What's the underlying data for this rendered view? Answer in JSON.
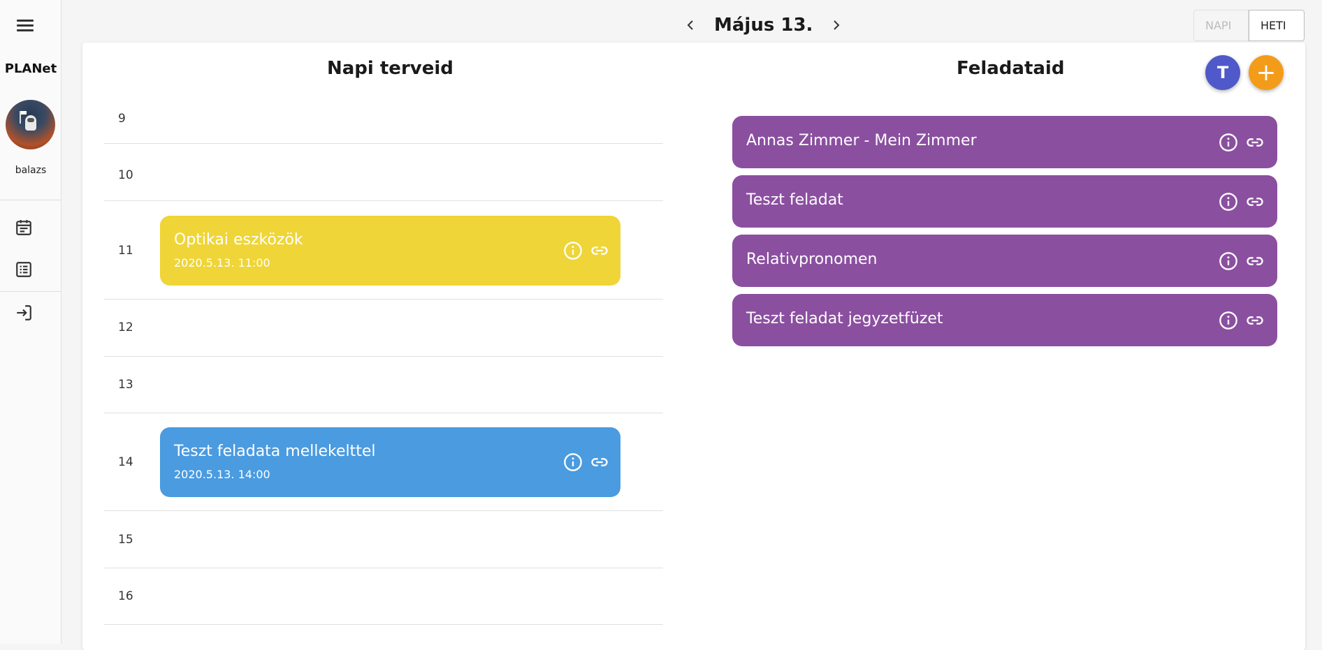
{
  "app": {
    "brand": "PLANet",
    "username": "balazs"
  },
  "header": {
    "date_title": "Május 13.",
    "view_daily": "NAPI",
    "view_weekly": "HETI"
  },
  "planner": {
    "title": "Napi terveid",
    "hours": [
      "9",
      "10",
      "11",
      "12",
      "13",
      "14",
      "15",
      "16"
    ],
    "events": [
      {
        "title": "Optikai eszközök",
        "time": "2020.5.13. 11:00",
        "color": "#efd537"
      },
      {
        "title": "Teszt feladata mellekelttel",
        "time": "2020.5.13. 14:00",
        "color": "#4a9be0"
      }
    ]
  },
  "tasks": {
    "title": "Feladataid",
    "items": [
      {
        "label": "Annas Zimmer - Mein Zimmer"
      },
      {
        "label": "Teszt feladat"
      },
      {
        "label": "Relativpronomen"
      },
      {
        "label": "Teszt feladat jegyzetfüzet"
      }
    ],
    "color": "#8b4fa0"
  },
  "fabs": {
    "teams_label": "T",
    "add_label": "+"
  },
  "icons": [
    "menu-icon",
    "calendar-icon",
    "list-icon",
    "logout-icon",
    "chevron-left-icon",
    "chevron-right-icon",
    "info-icon",
    "link-icon",
    "teams-icon",
    "plus-icon"
  ]
}
